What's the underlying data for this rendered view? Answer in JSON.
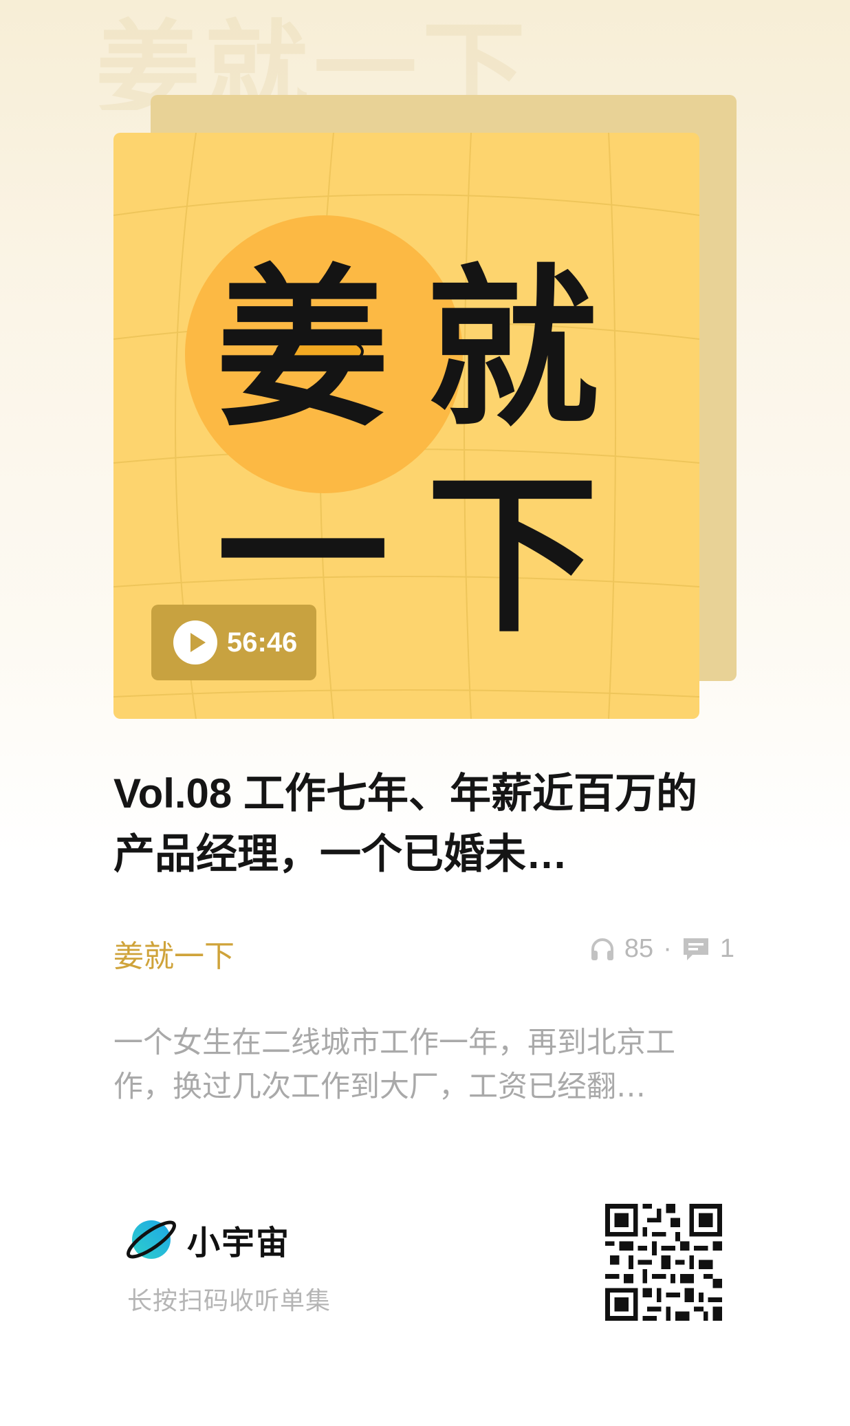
{
  "cover": {
    "watermark_text": "姜就一下",
    "char_1": "姜",
    "char_2": "就",
    "char_3": "一",
    "char_4": "下",
    "duration": "56:46",
    "colors": {
      "background": "#fdd46e",
      "circle": "#fcb944",
      "pill": "#c8a240"
    }
  },
  "episode": {
    "title": "Vol.08 工作七年、年薪近百万的产品经理，一个已婚未…",
    "podcast_name": "姜就一下",
    "plays": "85",
    "comments": "1",
    "description": "一个女生在二线城市工作一年，再到北京工作，换过几次工作到大厂，工资已经翻…"
  },
  "footer": {
    "brand_name": "小宇宙",
    "scan_hint": "长按扫码收听单集"
  },
  "icons": {
    "play": "play-icon",
    "headphones": "headphones-icon",
    "comment": "comment-icon",
    "logo": "planet-logo-icon",
    "qr": "qr-code"
  }
}
